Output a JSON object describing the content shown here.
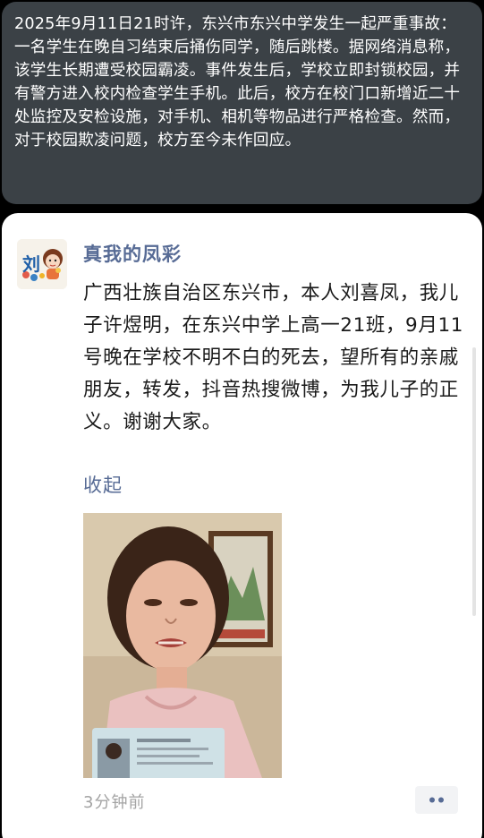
{
  "caption": {
    "text": "2025年9月11日21时许，东兴市东兴中学发生一起严重事故：一名学生在晚自习结束后捅伤同学，随后跳楼。据网络消息称，该学生长期遭受校园霸凌。事件发生后，学校立即封锁校园，并有警方进入校内检查学生手机。此后，校方在校门口新增近二十处监控及安检设施，对手机、相机等物品进行严格检查。然而，对于校园欺凌问题，校方至今未作回应。"
  },
  "post": {
    "author": "真我的凤彩",
    "text": "广西壮族自治区东兴市，本人刘喜凤，我儿子许煜明，在东兴中学上高一21班，9月11号晚在学校不明不白的死去，望所有的亲戚朋友，转发，抖音热搜微博，为我儿子的正义。谢谢大家。",
    "collapse_label": "收起",
    "time": "3分钟前",
    "avatar_text": "刘",
    "photo_desc": "photo"
  },
  "colors": {
    "link": "#576b95",
    "caption_bg": "#3b4146",
    "card_bg": "#ffffff"
  }
}
